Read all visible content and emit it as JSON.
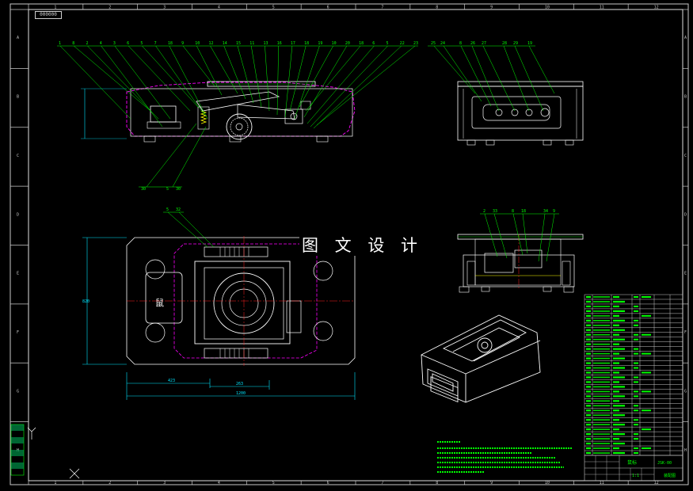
{
  "sheet": {
    "drawing_number": "000000",
    "watermark": "图 文 设 计",
    "column_labels": [
      "1",
      "2",
      "3",
      "4",
      "5",
      "6",
      "7",
      "8",
      "9",
      "10",
      "11",
      "12"
    ],
    "row_labels": [
      "A",
      "B",
      "C",
      "D",
      "E",
      "F",
      "G",
      "H"
    ]
  },
  "views": {
    "front": {
      "balloons": [
        "1",
        "8",
        "2",
        "4",
        "3",
        "6",
        "5",
        "7",
        "18",
        "9",
        "10",
        "12",
        "14",
        "15",
        "11",
        "13",
        "16",
        "17",
        "18",
        "19",
        "10",
        "20",
        "18",
        "6",
        "5",
        "22",
        "23"
      ],
      "lower_balloons": [
        "30",
        "5",
        "30"
      ]
    },
    "side_right": {
      "balloons": [
        "25",
        "24",
        "8",
        "26",
        "27",
        "28",
        "29",
        "19"
      ]
    },
    "top": {
      "balloons": [
        "5",
        "32"
      ],
      "dimensions": [
        "423",
        "263",
        "1200"
      ],
      "left_height_dim": "820"
    },
    "section_right": {
      "balloons": [
        "2",
        "33",
        "8",
        "18",
        "34",
        "9"
      ]
    }
  },
  "title_block": {
    "name": "鼠标",
    "code": "JSK-00",
    "scale": "1:1",
    "material_note": "装配图"
  },
  "colors": {
    "line": "#ffffff",
    "accent": "#00ff00",
    "cyan": "#00e5ff",
    "magenta": "#ff00ff",
    "yellow": "#ffff00",
    "red": "#ff2222"
  }
}
